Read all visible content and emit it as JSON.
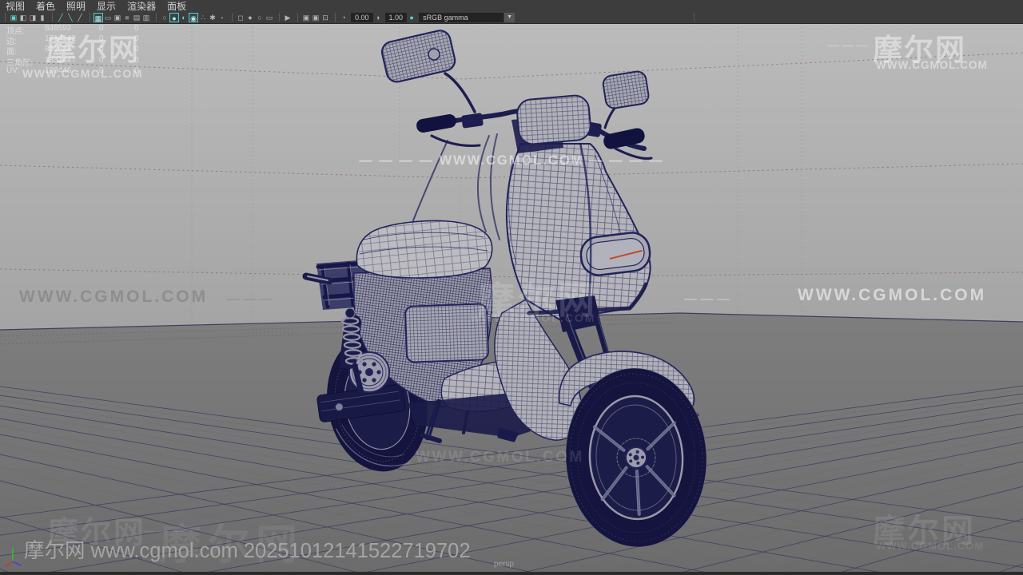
{
  "window": {
    "menu": [
      "视图",
      "着色",
      "照明",
      "显示",
      "渲染器",
      "面板"
    ]
  },
  "toolbar": {
    "icons": [
      {
        "name": "camera-icon",
        "glyph": "▣"
      },
      {
        "name": "camera-prev-icon",
        "glyph": "◧"
      },
      {
        "name": "camera-next-icon",
        "glyph": "◨"
      },
      {
        "name": "bookmark-icon",
        "glyph": "▮"
      },
      {
        "name": "pencil-tool-icon",
        "glyph": "╱"
      },
      {
        "name": "pen-tool-icon",
        "glyph": "╲"
      },
      {
        "name": "brush-tool-icon",
        "glyph": "╱"
      },
      {
        "name": "grid-toggle-icon",
        "glyph": "▦"
      },
      {
        "name": "film-gate-icon",
        "glyph": "▭"
      },
      {
        "name": "resolution-gate-icon",
        "glyph": "▣"
      },
      {
        "name": "gate-mask-icon",
        "glyph": "■"
      },
      {
        "name": "field-chart-icon",
        "glyph": "▤"
      },
      {
        "name": "safe-action-icon",
        "glyph": "▥"
      },
      {
        "name": "wireframe-mode-icon",
        "glyph": "○"
      },
      {
        "name": "shaded-mode-icon",
        "glyph": "●"
      },
      {
        "name": "textured-mode-icon",
        "glyph": "◐"
      },
      {
        "name": "lights-mode-icon",
        "glyph": "◉"
      },
      {
        "name": "shadows-icon",
        "glyph": "∴"
      },
      {
        "name": "ao-icon",
        "glyph": "✱"
      },
      {
        "name": "aa-icon",
        "glyph": "▪"
      },
      {
        "name": "xray-icon",
        "glyph": "◻"
      },
      {
        "name": "joints-icon",
        "glyph": "●"
      },
      {
        "name": "backface-icon",
        "glyph": "○"
      },
      {
        "name": "plane-icon",
        "glyph": "▭"
      },
      {
        "name": "selection-icon",
        "glyph": "▶"
      },
      {
        "name": "isolate-icon",
        "glyph": "▣"
      },
      {
        "name": "layer-icon",
        "glyph": "▣"
      },
      {
        "name": "screen-icon",
        "glyph": "⊡"
      },
      {
        "name": "gamma-icon",
        "glyph": "◔"
      },
      {
        "name": "exposure-icon",
        "glyph": "◑"
      },
      {
        "name": "colorspace-icon",
        "glyph": "●"
      }
    ],
    "fields": {
      "exposure": "0.00",
      "gamma": "1.00",
      "colorspace": "sRGB gamma",
      "dropdown_arrow": "▼"
    }
  },
  "hud": {
    "rows": [
      {
        "label": "顶点:",
        "v1": "848592",
        "v2": "0",
        "v3": "0"
      },
      {
        "label": "边:",
        "v1": "1714142",
        "v2": "0",
        "v3": "0"
      },
      {
        "label": "面:",
        "v1": "851632",
        "v2": "0",
        "v3": "0"
      },
      {
        "label": "三角形:",
        "v1": "1331447",
        "v2": "0",
        "v3": "0"
      },
      {
        "label": "UV:",
        "v1": "109446",
        "v2": "0",
        "v3": "0"
      }
    ]
  },
  "viewport": {
    "camera_label": "persp"
  },
  "watermark": {
    "logo": "摩尔网",
    "url": "WWW.CGMOL.COM",
    "dashes": "— — — — —",
    "dashes_short": "— — —",
    "center_line": "— — — —  WWW.CGMOL.COM  — — — —"
  },
  "footer": {
    "text": "摩尔网 www.cgmol.com 20251012141522719702"
  },
  "colors": {
    "wire": "#23235c",
    "accent_teal": "#5fc6c9",
    "background_top": "#bdbdbd",
    "background_bottom": "#a7a7a7",
    "ground": "#7b7b7b",
    "headlight_accent": "#c2502e"
  }
}
